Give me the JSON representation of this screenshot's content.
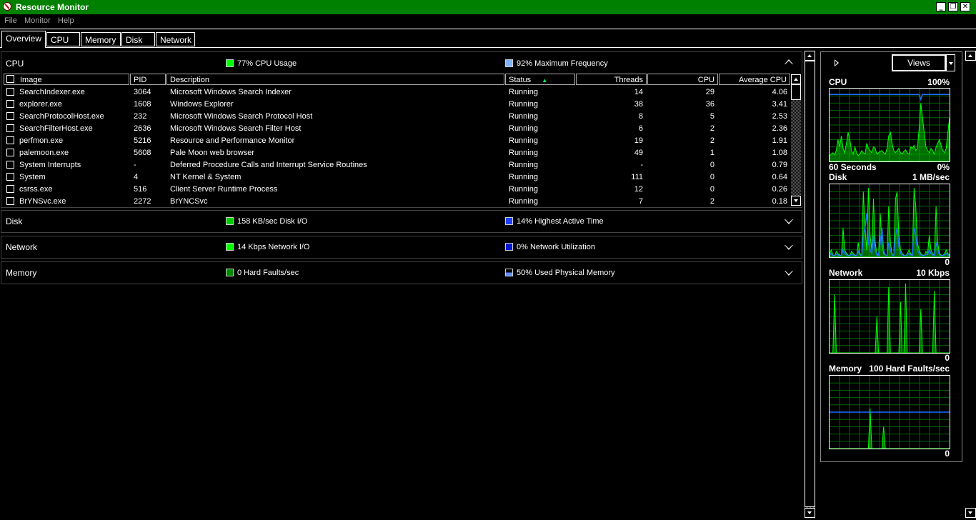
{
  "window": {
    "title": "Resource Monitor",
    "minimize": "_",
    "restore": "❐",
    "close": "✕"
  },
  "menu": [
    "File",
    "Monitor",
    "Help"
  ],
  "tabs": [
    "Overview",
    "CPU",
    "Memory",
    "Disk",
    "Network"
  ],
  "active_tab": "Overview",
  "colors": {
    "titlebar": "#008000",
    "green": "#00ff00",
    "blue": "#1f6fff",
    "light_blue": "#7fb2ff"
  },
  "sections": {
    "cpu": {
      "title": "CPU",
      "metric1": "77% CPU Usage",
      "metric2": "92% Maximum Frequency",
      "expanded": true
    },
    "disk": {
      "title": "Disk",
      "metric1": "158 KB/sec Disk I/O",
      "metric2": "14% Highest Active Time"
    },
    "network": {
      "title": "Network",
      "metric1": "14 Kbps Network I/O",
      "metric2": "0% Network Utilization"
    },
    "memory": {
      "title": "Memory",
      "metric1": "0 Hard Faults/sec",
      "metric2": "50% Used Physical Memory"
    }
  },
  "table": {
    "columns": [
      "Image",
      "PID",
      "Description",
      "Status",
      "Threads",
      "CPU",
      "Average CPU"
    ],
    "sort_indicator": "▲",
    "rows": [
      [
        "SearchIndexer.exe",
        "3064",
        "Microsoft Windows Search Indexer",
        "Running",
        "14",
        "29",
        "4.06"
      ],
      [
        "explorer.exe",
        "1608",
        "Windows Explorer",
        "Running",
        "38",
        "36",
        "3.41"
      ],
      [
        "SearchProtocolHost.exe",
        "232",
        "Microsoft Windows Search Protocol Host",
        "Running",
        "8",
        "5",
        "2.53"
      ],
      [
        "SearchFilterHost.exe",
        "2636",
        "Microsoft Windows Search Filter Host",
        "Running",
        "6",
        "2",
        "2.36"
      ],
      [
        "perfmon.exe",
        "5216",
        "Resource and Performance Monitor",
        "Running",
        "19",
        "2",
        "1.91"
      ],
      [
        "palemoon.exe",
        "5608",
        "Pale Moon web browser",
        "Running",
        "49",
        "1",
        "1.08"
      ],
      [
        "System Interrupts",
        "-",
        "Deferred Procedure Calls and Interrupt Service Routines",
        "Running",
        "-",
        "0",
        "0.79"
      ],
      [
        "System",
        "4",
        "NT Kernel & System",
        "Running",
        "111",
        "0",
        "0.64"
      ],
      [
        "csrss.exe",
        "516",
        "Client Server Runtime Process",
        "Running",
        "12",
        "0",
        "0.26"
      ],
      [
        "BrYNSvc.exe",
        "2272",
        "BrYNCSvc",
        "Running",
        "7",
        "2",
        "0.18"
      ]
    ]
  },
  "right_panel": {
    "views_label": "Views",
    "graphs": {
      "cpu": {
        "label": "CPU",
        "max": "100%",
        "footer_left": "60 Seconds",
        "footer_right": "0%"
      },
      "disk": {
        "label": "Disk",
        "max": "1 MB/sec",
        "footer_right": "0"
      },
      "network": {
        "label": "Network",
        "max": "10 Kbps",
        "footer_right": "0"
      },
      "memory": {
        "label": "Memory",
        "max": "100 Hard Faults/sec",
        "footer_right": "0"
      }
    },
    "series": {
      "cpu_usage": [
        8,
        10,
        12,
        9,
        15,
        30,
        20,
        35,
        18,
        12,
        25,
        40,
        30,
        15,
        10,
        20,
        12,
        8,
        10,
        15,
        12,
        10,
        25,
        18,
        15,
        12,
        20,
        18,
        10,
        12,
        14,
        15,
        12,
        10,
        18,
        35,
        40,
        25,
        15,
        12,
        15,
        18,
        12,
        10,
        14,
        16,
        12,
        10,
        20,
        18,
        22,
        15,
        18,
        45,
        80,
        60,
        40,
        20,
        15,
        12,
        18,
        15,
        10,
        20,
        25,
        30,
        22,
        15,
        12,
        18,
        40,
        60
      ],
      "cpu_freq": [
        92,
        92,
        92,
        92,
        92,
        92,
        92,
        92,
        92,
        92,
        92,
        92,
        92,
        92,
        92,
        92,
        92,
        92,
        92,
        92,
        92,
        92,
        92,
        92,
        92,
        92,
        92,
        92,
        92,
        92,
        92,
        92,
        92,
        92,
        92,
        92,
        92,
        92,
        92,
        92,
        92,
        92,
        92,
        92,
        92,
        92,
        92,
        92,
        92,
        92,
        92,
        92,
        92,
        92,
        85,
        92,
        92,
        92,
        92,
        92,
        92,
        92,
        92,
        92,
        92,
        92,
        92,
        92,
        92,
        92,
        92,
        92
      ],
      "disk_io": [
        5,
        10,
        3,
        2,
        8,
        5,
        3,
        2,
        40,
        10,
        5,
        3,
        2,
        8,
        5,
        3,
        2,
        20,
        5,
        3,
        90,
        40,
        10,
        95,
        30,
        10,
        80,
        20,
        5,
        3,
        60,
        20,
        5,
        3,
        2,
        70,
        20,
        5,
        3,
        80,
        90,
        30,
        10,
        5,
        3,
        2,
        5,
        10,
        5,
        3,
        95,
        70,
        20,
        10,
        5,
        3,
        2,
        8,
        5,
        30,
        10,
        5,
        3,
        70,
        20,
        5,
        3,
        2,
        5,
        10,
        5,
        3
      ],
      "disk_active": [
        3,
        5,
        2,
        2,
        4,
        3,
        2,
        2,
        10,
        5,
        3,
        2,
        2,
        4,
        3,
        2,
        2,
        8,
        3,
        2,
        30,
        40,
        60,
        20,
        10,
        5,
        30,
        10,
        3,
        2,
        20,
        40,
        10,
        3,
        2,
        20,
        10,
        3,
        2,
        30,
        40,
        15,
        5,
        3,
        2,
        2,
        3,
        5,
        3,
        2,
        40,
        30,
        10,
        5,
        3,
        2,
        2,
        4,
        3,
        10,
        5,
        3,
        2,
        20,
        10,
        3,
        2,
        2,
        3,
        5,
        3,
        2
      ],
      "network_io": [
        0,
        0,
        0,
        80,
        0,
        0,
        0,
        0,
        0,
        0,
        0,
        0,
        0,
        0,
        0,
        0,
        0,
        0,
        0,
        0,
        0,
        0,
        0,
        0,
        0,
        0,
        0,
        0,
        50,
        0,
        0,
        0,
        0,
        0,
        0,
        90,
        0,
        0,
        0,
        0,
        0,
        0,
        70,
        0,
        0,
        95,
        0,
        0,
        0,
        0,
        0,
        0,
        0,
        0,
        60,
        0,
        0,
        0,
        0,
        0,
        0,
        0,
        85,
        0,
        0,
        0,
        0,
        0,
        0,
        0,
        0,
        0
      ],
      "hard_faults": [
        0,
        0,
        0,
        0,
        0,
        0,
        0,
        0,
        0,
        0,
        0,
        0,
        0,
        0,
        0,
        0,
        0,
        0,
        0,
        0,
        0,
        0,
        0,
        0,
        55,
        0,
        0,
        0,
        0,
        0,
        0,
        0,
        30,
        0,
        0,
        0,
        0,
        0,
        0,
        0,
        0,
        0,
        0,
        0,
        0,
        0,
        0,
        0,
        0,
        0,
        0,
        0,
        0,
        0,
        0,
        0,
        0,
        0,
        0,
        0,
        0,
        0,
        0,
        0,
        0,
        0,
        0,
        0,
        0,
        0,
        0,
        0
      ],
      "used_memory": [
        50,
        50,
        50,
        50,
        50,
        50,
        50,
        50,
        50,
        50,
        50,
        50,
        50,
        50,
        50,
        50,
        50,
        50,
        50,
        50,
        50,
        50,
        50,
        50,
        50,
        50,
        50,
        50,
        50,
        50,
        50,
        50,
        50,
        50,
        50,
        50,
        50,
        50,
        50,
        50,
        50,
        50,
        50,
        50,
        50,
        50,
        50,
        50,
        50,
        50,
        50,
        50,
        50,
        50,
        50,
        50,
        50,
        50,
        50,
        50,
        50,
        50,
        50,
        50,
        50,
        50,
        50,
        50,
        50,
        50,
        50,
        50
      ]
    }
  }
}
